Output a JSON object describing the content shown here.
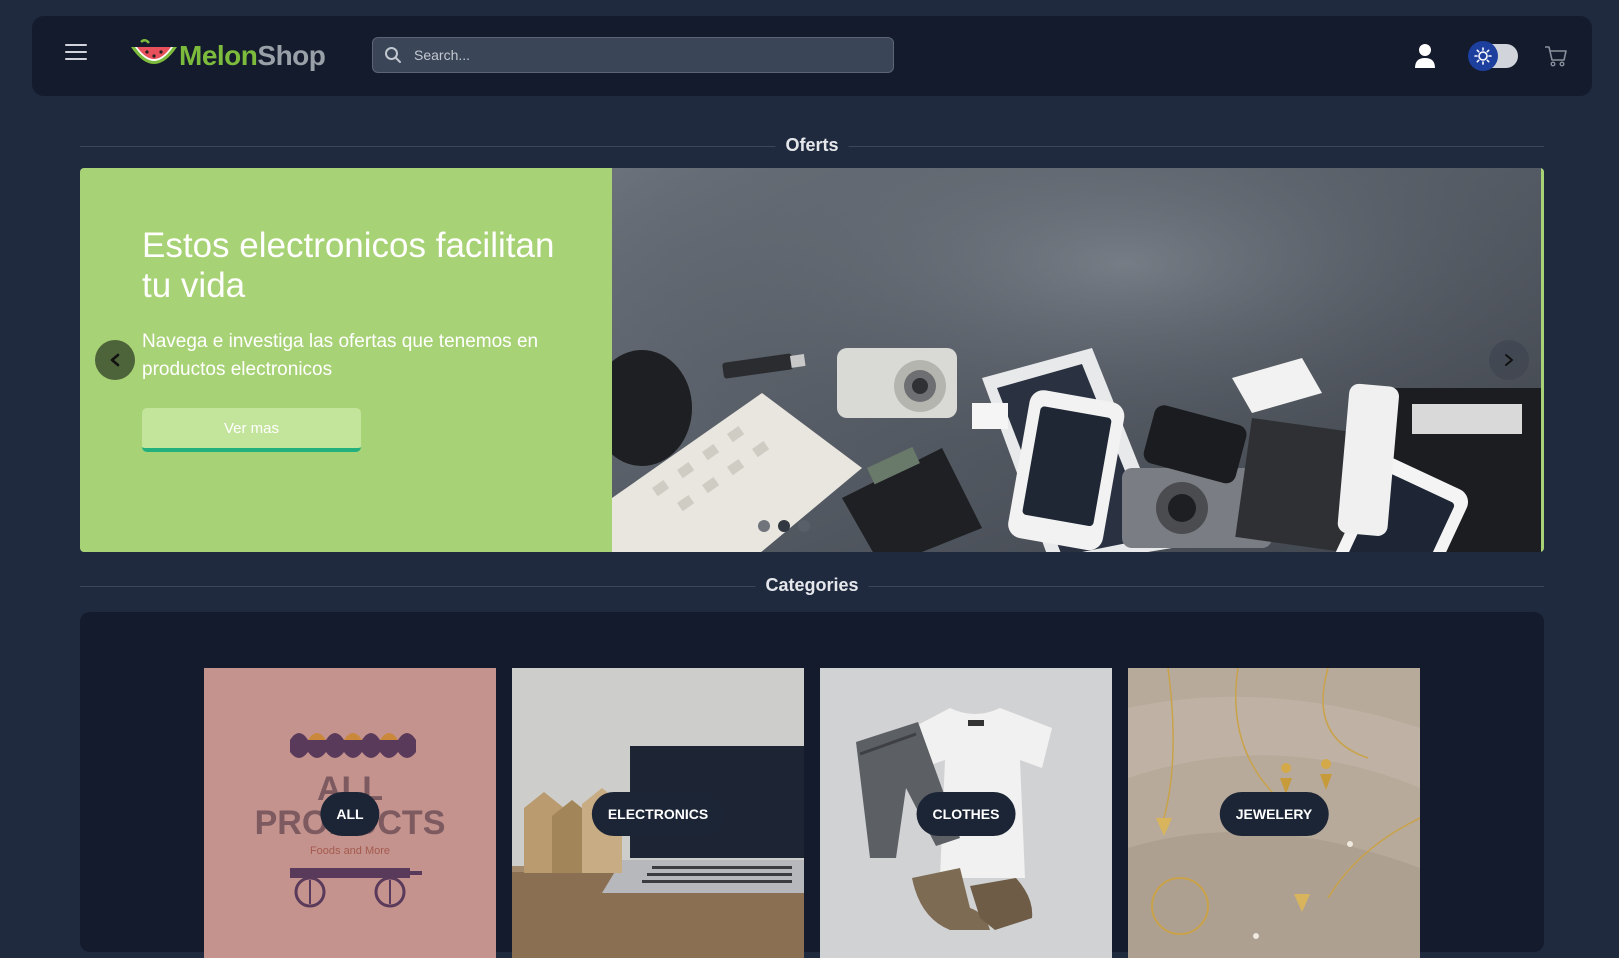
{
  "brand": {
    "name_part1": "Melon",
    "name_part2": "Shop"
  },
  "search": {
    "placeholder": "Search..."
  },
  "icons": {
    "menu": "hamburger-menu-icon",
    "search": "search-icon",
    "user": "user-icon",
    "theme": "sun-icon",
    "cart": "cart-icon",
    "prev": "chevron-left-icon",
    "next": "chevron-right-icon"
  },
  "colors": {
    "page_bg": "#1f2a3f",
    "navbar_bg": "#131b2d",
    "slide_bg": "#a8d276",
    "button_accent": "#22b07d",
    "brand_green": "#7dbb3c"
  },
  "offers": {
    "section_title": "Oferts",
    "slide": {
      "title": "Estos electronicos facilitan tu vida",
      "description": "Navega e investiga las ofertas que tenemos en productos electronicos",
      "button_label": "Ver mas"
    },
    "dots_count": 3,
    "active_dot": 2
  },
  "categories": {
    "section_title": "Categories",
    "items": [
      {
        "label": "ALL",
        "image_text_1": "ALL",
        "image_text_2": "PRODUCTS",
        "image_text_3": "Foods and More"
      },
      {
        "label": "ELECTRONICS"
      },
      {
        "label": "CLOTHES"
      },
      {
        "label": "JEWELERY"
      }
    ]
  }
}
